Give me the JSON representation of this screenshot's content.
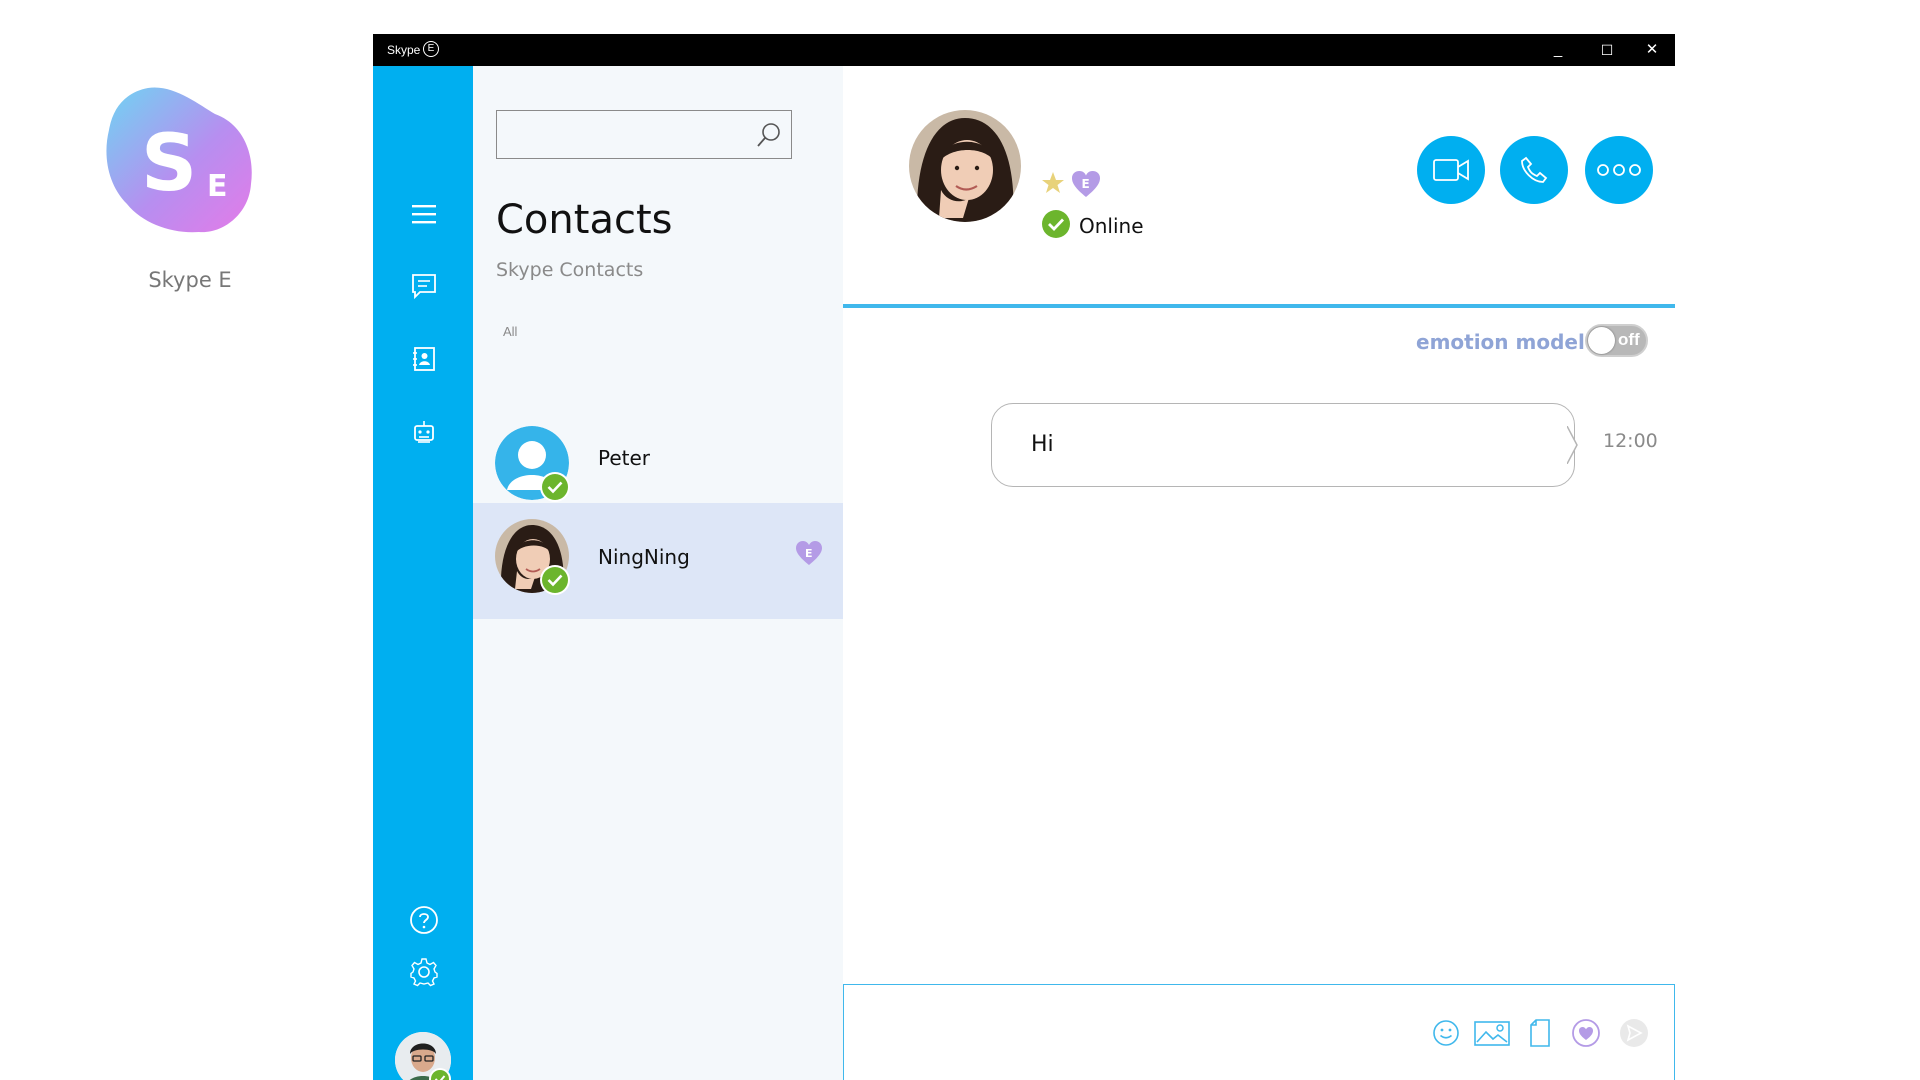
{
  "desktop": {
    "app_label": "Skype E",
    "logo_letter": "S",
    "logo_sub_letter": "E"
  },
  "window": {
    "title": "Skype",
    "title_badge": "E",
    "controls": {
      "minimize": "_",
      "maximize": "☐",
      "close": "✕"
    }
  },
  "rail": {
    "items": [
      {
        "name": "menu",
        "icon": "hamburger-menu-icon"
      },
      {
        "name": "chats",
        "icon": "chat-icon"
      },
      {
        "name": "contacts",
        "icon": "contacts-book-icon"
      },
      {
        "name": "bots",
        "icon": "bot-icon"
      }
    ],
    "bottom": [
      {
        "name": "help",
        "icon": "help-icon"
      },
      {
        "name": "settings",
        "icon": "gear-icon"
      }
    ],
    "profile_status": "online"
  },
  "contacts_panel": {
    "search_value": "",
    "title": "Contacts",
    "subtitle": "Skype Contacts",
    "filter": "All",
    "contacts": [
      {
        "name": "Peter",
        "status": "online",
        "selected": false,
        "emotion_badge": ""
      },
      {
        "name": "NingNing",
        "status": "online",
        "selected": true,
        "emotion_badge": "E"
      }
    ]
  },
  "chat": {
    "contact_status": "Online",
    "badge_letter": "E",
    "actions": [
      {
        "name": "video-call",
        "icon": "video-camera-icon"
      },
      {
        "name": "voice-call",
        "icon": "phone-icon"
      },
      {
        "name": "more",
        "icon": "more-dots-icon"
      }
    ],
    "emotion_model_label": "emotion model",
    "emotion_toggle_text": "off",
    "messages": [
      {
        "text": "Hi",
        "time": "12:00"
      }
    ],
    "composer": {
      "value": "",
      "tools": [
        "emoji-icon",
        "image-icon",
        "file-icon",
        "emotion-heart-icon",
        "send-icon"
      ]
    }
  },
  "colors": {
    "accent": "#00aff0",
    "rail": "#00aff0",
    "selected_row": "#dde6f7",
    "emotion_purple": "#b49be6",
    "presence_green": "#6cb52d",
    "star": "#e8d27a"
  }
}
